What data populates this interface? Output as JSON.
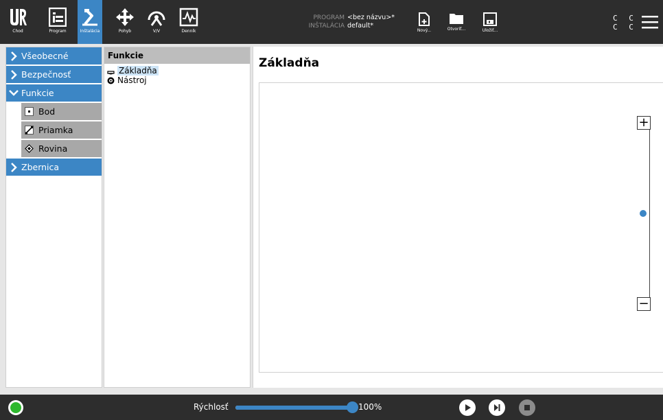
{
  "topbar": {
    "tabs": [
      {
        "label": "Chod",
        "icon": "ur-logo-icon"
      },
      {
        "label": "Program",
        "icon": "program-icon"
      },
      {
        "label": "Inštalácia",
        "icon": "installation-icon",
        "active": true
      },
      {
        "label": "Pohyb",
        "icon": "move-icon"
      },
      {
        "label": "V/V",
        "icon": "io-icon"
      },
      {
        "label": "Denník",
        "icon": "log-icon"
      }
    ],
    "program_key": "PROGRAM",
    "program_value": "<bez názvu>*",
    "installation_key": "INŠTALÁCIA",
    "installation_value": "default*",
    "new_label": "Nový...",
    "open_label": "Otvoriť...",
    "save_label": "Uložiť...",
    "cc_top": "C C",
    "cc_bottom": "C C"
  },
  "leftnav": {
    "items": [
      {
        "label": "Všeobecné"
      },
      {
        "label": "Bezpečnosť"
      },
      {
        "label": "Funkcie"
      },
      {
        "label": "Bod"
      },
      {
        "label": "Priamka"
      },
      {
        "label": "Rovina"
      },
      {
        "label": "Zbernica"
      }
    ]
  },
  "tree": {
    "header": "Funkcie",
    "rows": [
      {
        "label": "Základňa",
        "icon": "base-icon",
        "selected": true
      },
      {
        "label": "Nástroj",
        "icon": "tool-icon"
      }
    ]
  },
  "main": {
    "title": "Základňa",
    "zoom_in": "+",
    "zoom_out": "−",
    "zoom_level": 0.5
  },
  "bottombar": {
    "speed_label": "Rýchlosť",
    "speed_value": "100%",
    "speed_fraction": 1.0
  },
  "colors": {
    "accent": "#3c86c5",
    "topbar": "#2d2d2d",
    "power_on": "#2eb82e"
  }
}
